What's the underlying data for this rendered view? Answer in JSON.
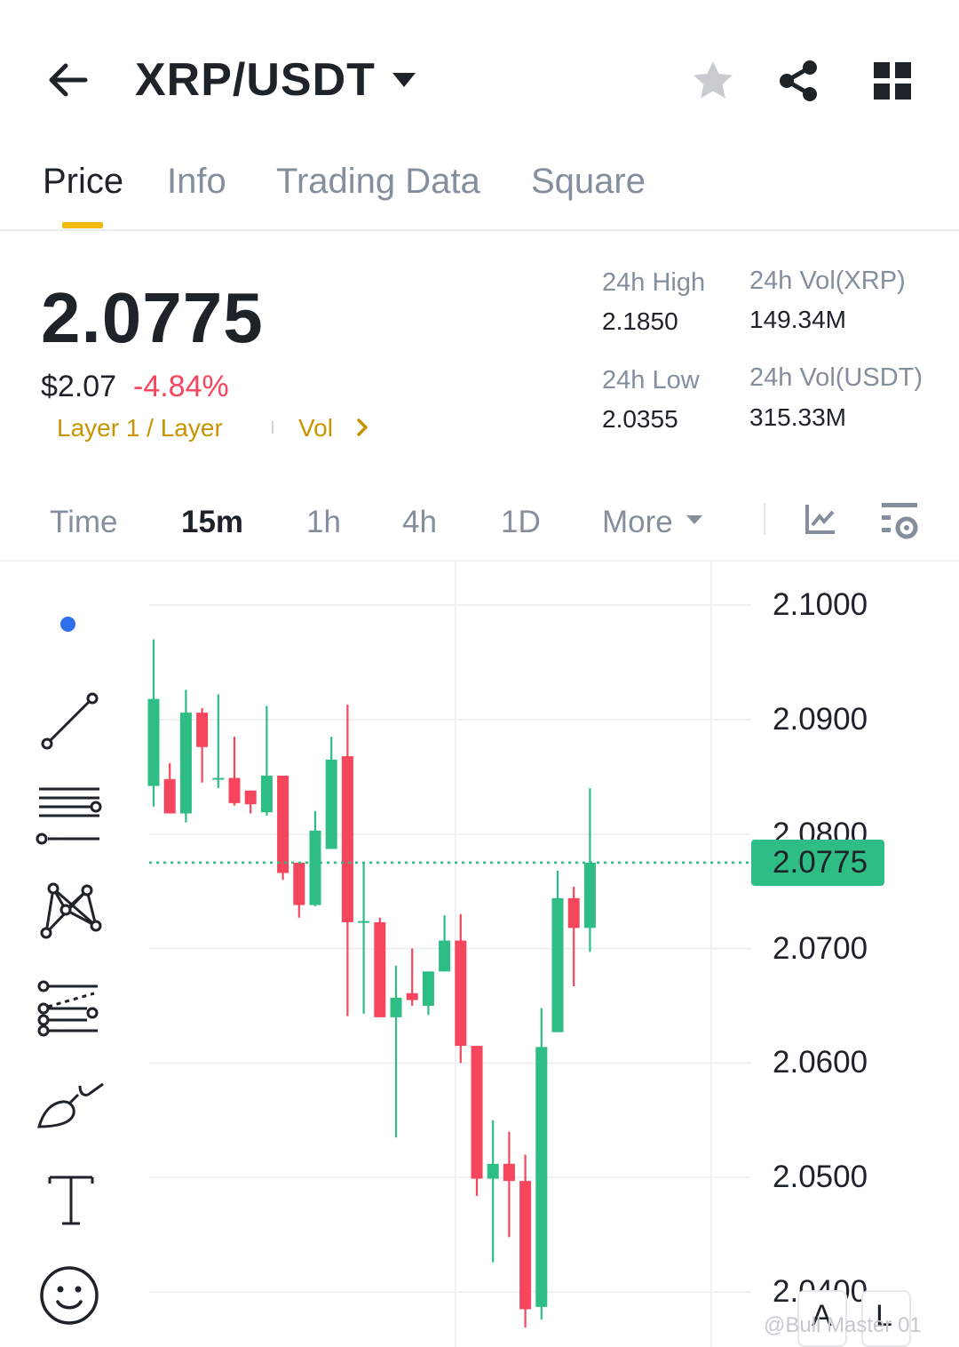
{
  "header": {
    "pair": "XRP/USDT",
    "icons": [
      "back-arrow-icon",
      "dropdown-caret-icon",
      "star-icon",
      "share-icon",
      "grid-icon"
    ]
  },
  "tabs": [
    {
      "label": "Price",
      "active": true
    },
    {
      "label": "Info",
      "active": false
    },
    {
      "label": "Trading Data",
      "active": false
    },
    {
      "label": "Square",
      "active": false
    }
  ],
  "ticker": {
    "last_price": "2.0775",
    "usd_price": "$2.07",
    "change_pct": "-4.84%",
    "tag_category": "Layer 1 / Layer",
    "tag_vol": "Vol",
    "high_label": "24h High",
    "high_value": "2.1850",
    "low_label": "24h Low",
    "low_value": "2.0355",
    "vol_base_label": "24h Vol(XRP)",
    "vol_base_value": "149.34M",
    "vol_quote_label": "24h Vol(USDT)",
    "vol_quote_value": "315.33M"
  },
  "intervals": {
    "items": [
      "Time",
      "15m",
      "1h",
      "4h",
      "1D",
      "More"
    ],
    "selected": "15m"
  },
  "tools": [
    "trend-line-icon",
    "horizontal-lines-icon",
    "pattern-icon",
    "fib-icon",
    "brush-icon",
    "text-icon",
    "emoji-icon"
  ],
  "colors": {
    "up": "#2ebd85",
    "down": "#f6465d",
    "accent": "#f0b90b",
    "muted": "#848e9c"
  },
  "price_axis": [
    "2.1000",
    "2.0900",
    "2.0800",
    "2.0700",
    "2.0600",
    "2.0500",
    "2.0400"
  ],
  "current_price_tag": "2.0775",
  "bottom_buttons": [
    "A",
    "L"
  ],
  "watermark": "@Bull Master 01",
  "chart_data": {
    "type": "candlestick",
    "interval": "15m",
    "ylim": [
      2.0352,
      2.1038
    ],
    "current_price": 2.0775,
    "candles": [
      {
        "o": 2.0842,
        "h": 2.097,
        "l": 2.0824,
        "c": 2.0918
      },
      {
        "o": 2.0848,
        "h": 2.0862,
        "l": 2.0818,
        "c": 2.0818
      },
      {
        "o": 2.0818,
        "h": 2.0926,
        "l": 2.081,
        "c": 2.0906
      },
      {
        "o": 2.0906,
        "h": 2.091,
        "l": 2.0845,
        "c": 2.0876
      },
      {
        "o": 2.0849,
        "h": 2.0922,
        "l": 2.084,
        "c": 2.0849
      },
      {
        "o": 2.0849,
        "h": 2.0885,
        "l": 2.0825,
        "c": 2.0827
      },
      {
        "o": 2.0838,
        "h": 2.0838,
        "l": 2.0818,
        "c": 2.0826
      },
      {
        "o": 2.0819,
        "h": 2.0912,
        "l": 2.0816,
        "c": 2.0851
      },
      {
        "o": 2.0851,
        "h": 2.0851,
        "l": 2.076,
        "c": 2.0766
      },
      {
        "o": 2.0775,
        "h": 2.0775,
        "l": 2.0727,
        "c": 2.0738
      },
      {
        "o": 2.0738,
        "h": 2.082,
        "l": 2.0737,
        "c": 2.0803
      },
      {
        "o": 2.0787,
        "h": 2.0885,
        "l": 2.08,
        "c": 2.0865
      },
      {
        "o": 2.0868,
        "h": 2.0913,
        "l": 2.0641,
        "c": 2.0723
      },
      {
        "o": 2.0723,
        "h": 2.0775,
        "l": 2.0643,
        "c": 2.0724
      },
      {
        "o": 2.0723,
        "h": 2.0727,
        "l": 2.064,
        "c": 2.064
      },
      {
        "o": 2.064,
        "h": 2.0685,
        "l": 2.0535,
        "c": 2.0657
      },
      {
        "o": 2.0661,
        "h": 2.07,
        "l": 2.065,
        "c": 2.0655
      },
      {
        "o": 2.065,
        "h": 2.0676,
        "l": 2.0642,
        "c": 2.068
      },
      {
        "o": 2.068,
        "h": 2.0729,
        "l": 2.068,
        "c": 2.0707
      },
      {
        "o": 2.0707,
        "h": 2.073,
        "l": 2.06,
        "c": 2.0615
      },
      {
        "o": 2.0615,
        "h": 2.0608,
        "l": 2.0484,
        "c": 2.0499
      },
      {
        "o": 2.0499,
        "h": 2.055,
        "l": 2.0426,
        "c": 2.0512
      },
      {
        "o": 2.0512,
        "h": 2.054,
        "l": 2.0448,
        "c": 2.0497
      },
      {
        "o": 2.0497,
        "h": 2.052,
        "l": 2.0369,
        "c": 2.0385
      },
      {
        "o": 2.0387,
        "h": 2.0648,
        "l": 2.0376,
        "c": 2.0614
      },
      {
        "o": 2.0627,
        "h": 2.0768,
        "l": 2.0627,
        "c": 2.0744
      },
      {
        "o": 2.0744,
        "h": 2.0754,
        "l": 2.0667,
        "c": 2.0718
      },
      {
        "o": 2.0718,
        "h": 2.084,
        "l": 2.0697,
        "c": 2.0775
      }
    ]
  }
}
